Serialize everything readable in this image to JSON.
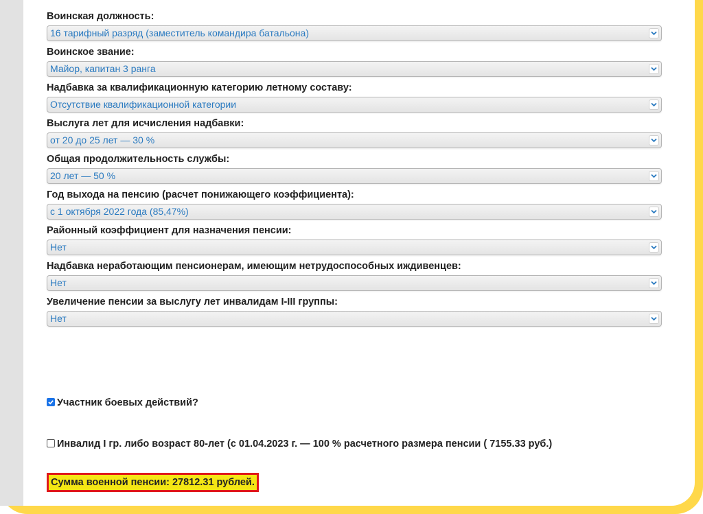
{
  "fields": [
    {
      "label": "Воинская должность:",
      "value": "16 тарифный разряд (заместитель командира батальона)"
    },
    {
      "label": "Воинское звание:",
      "value": "Майор, капитан 3 ранга"
    },
    {
      "label": "Надбавка за квалификационную категорию летному составу:",
      "value": "Отсутствие квалификационной категории"
    },
    {
      "label": "Выслуга лет для исчисления надбавки:",
      "value": "от 20 до 25 лет — 30 %"
    },
    {
      "label": "Общая продолжительность службы:",
      "value": "20 лет — 50 %"
    },
    {
      "label": "Год выхода на пенсию (расчет понижающего коэффициента):",
      "value": "с 1 октября 2022 года (85,47%)"
    },
    {
      "label": "Районный коэффициент для назначения пенсии:",
      "value": "Нет"
    },
    {
      "label": "Надбавка неработающим пенсионерам, имеющим нетрудоспособных иждивенцев:",
      "value": "Нет"
    },
    {
      "label": "Увеличение пенсии за выслугу лет инвалидам I-III группы:",
      "value": "Нет"
    }
  ],
  "checkboxes": {
    "combat": {
      "label": "Участник боевых действий?",
      "checked": true
    },
    "invalid": {
      "label": "Инвалид I гр. либо возраст 80-лет (с 01.04.2023 г. — 100 % расчетного размера пенсии ( 7155.33 руб.)",
      "checked": false
    }
  },
  "result": {
    "text": "Сумма военной пенсии:   27812.31 рублей."
  },
  "colors": {
    "frame": "#ffd84a",
    "select_text": "#2a7ac0",
    "result_bg": "#f5e614",
    "result_border": "#e0191b",
    "checkbox_checked": "#1a73e8"
  }
}
